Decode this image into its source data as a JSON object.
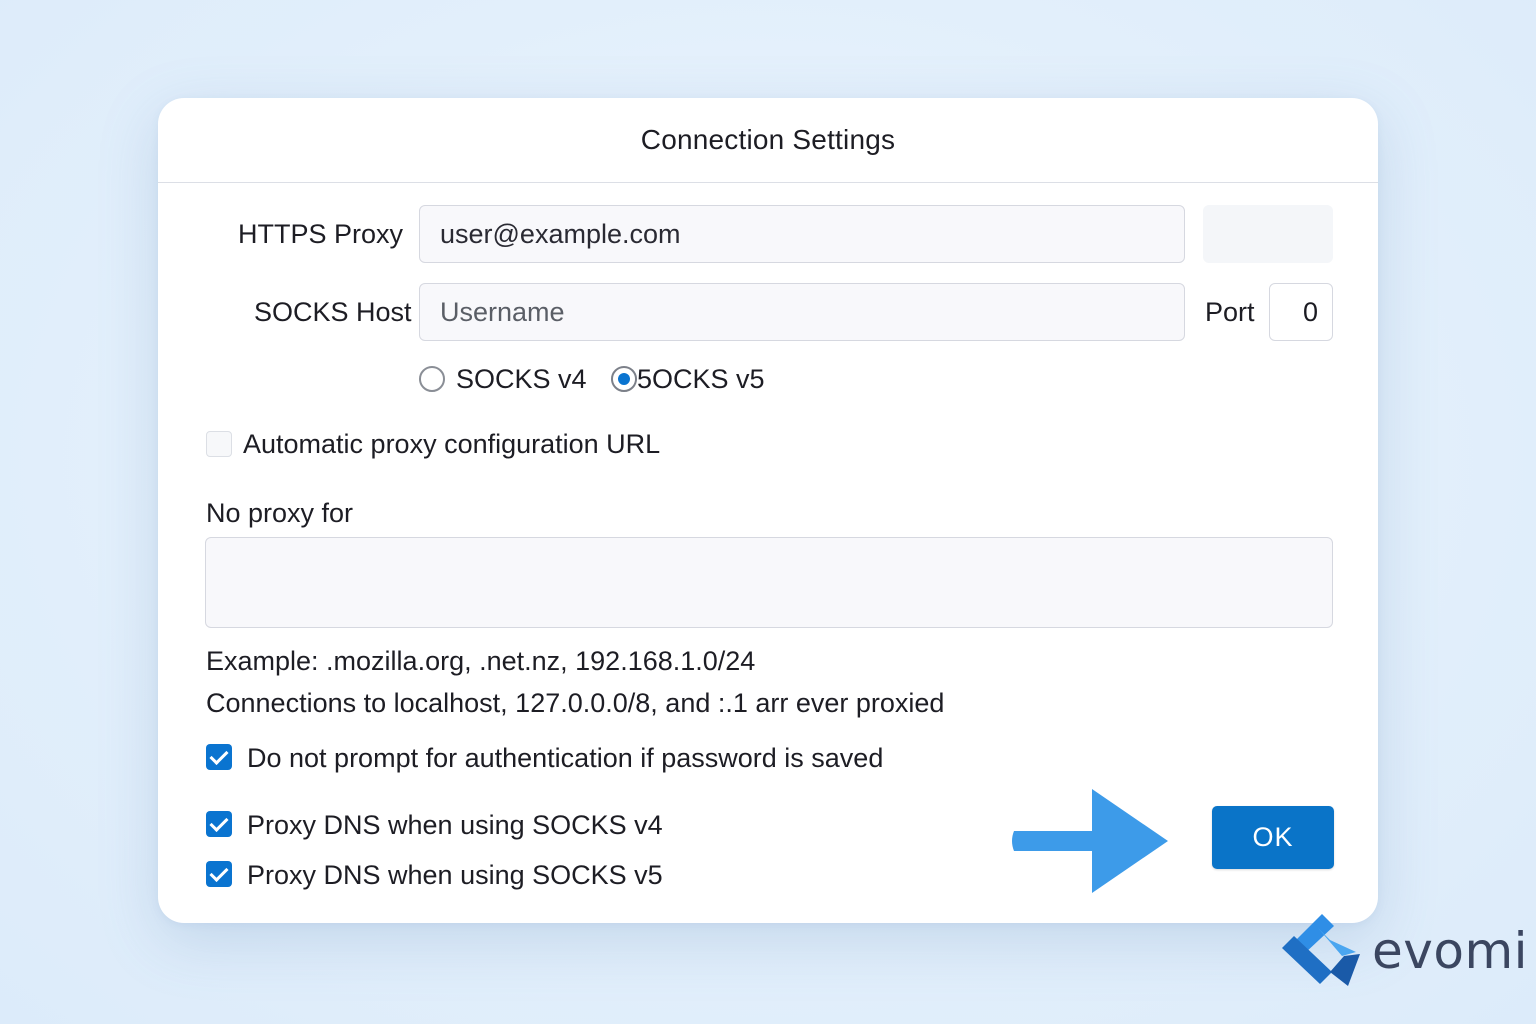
{
  "dialog": {
    "title": "Connection Settings",
    "https_proxy": {
      "label": "HTTPS Proxy",
      "value": "user@example.com"
    },
    "socks_host": {
      "label": "SOCKS Host",
      "placeholder": "Username"
    },
    "port": {
      "label": "Port",
      "value": "0"
    },
    "socks_version": {
      "options": [
        "SOCKS v4",
        "5OCKS v5"
      ],
      "selected": "5OCKS v5"
    },
    "auto_proxy": {
      "label": "Automatic proxy configuration URL",
      "checked": false
    },
    "no_proxy": {
      "label": "No proxy for",
      "value": "",
      "example": "Example:  .mozilla.org, .net.nz, 192.168.1.0/24",
      "note": "Connections to localhost, 127.0.0.0/8, and :.1 arr ever proxied"
    },
    "checkboxes": [
      {
        "label": "Do not prompt for authentication if password is saved",
        "checked": true
      },
      {
        "label": "Proxy DNS when using SOCKS v4",
        "checked": true
      },
      {
        "label": "Proxy DNS when using SOCKS v5",
        "checked": true
      }
    ],
    "ok_label": "OK"
  },
  "colors": {
    "accent": "#0a74c8",
    "arrow": "#3d9be9",
    "background": "#e4f0fb"
  },
  "brand": {
    "name": "evomi",
    "icon": "evomi-logo-icon"
  }
}
